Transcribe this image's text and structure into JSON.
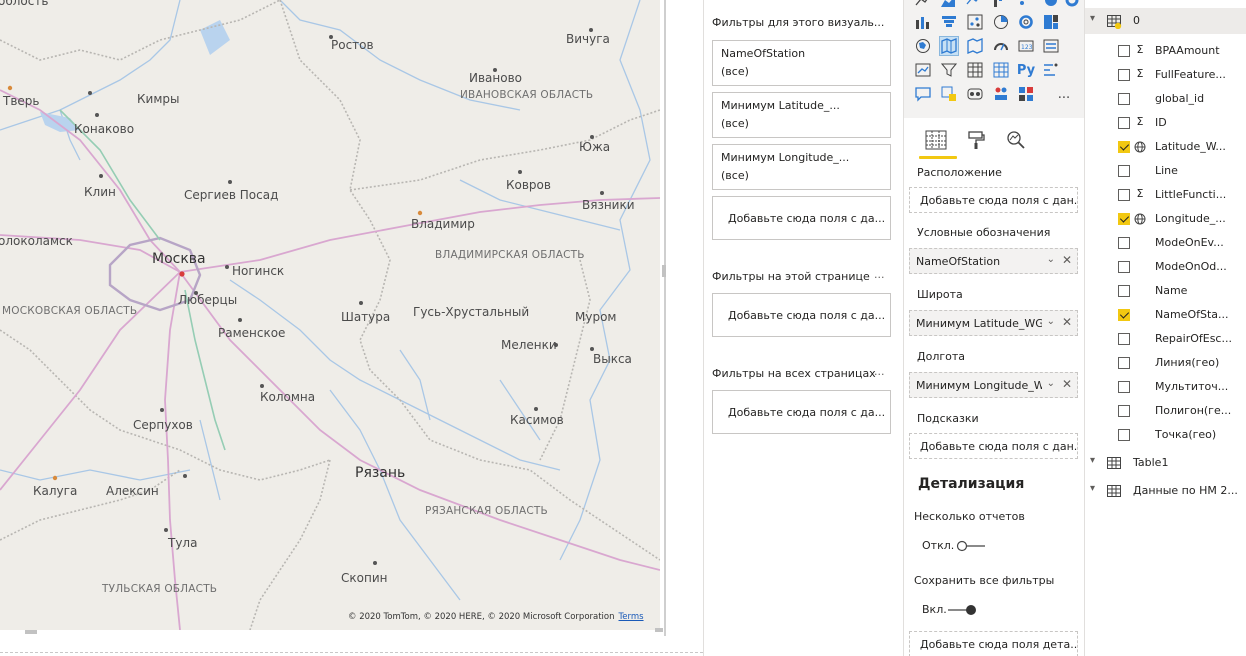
{
  "map": {
    "copyright": "© 2020 TomTom, © 2020 HERE, © 2020 Microsoft Corporation",
    "terms_link": "Terms",
    "cities": {
      "tver": "Тверь",
      "rostov": "Ростов",
      "vichuga": "Вичуга",
      "kimry": "Кимры",
      "ivanovo": "Иваново",
      "konakovo": "Конаково",
      "yuzha": "Южа",
      "klin": "Клин",
      "sergiev_posad": "Сергиев Посад",
      "kovrov": "Ковров",
      "vyazniki": "Вязники",
      "volokolamsk": "олоколамск",
      "vladimir": "Владимир",
      "moskva": "Москва",
      "noginsk": "Ногинск",
      "lyubertsy": "Люберцы",
      "shatura": "Шатура",
      "gus": "Гусь-Хрустальный",
      "murom": "Муром",
      "ramenskoe": "Раменское",
      "melenki": "Меленки",
      "vyksa": "Выкса",
      "kolomna": "Коломна",
      "serpukhov": "Серпухов",
      "kasimov": "Касимов",
      "ryazan": "Рязань",
      "kaluga": "Калуга",
      "aleksin": "Алексин",
      "tula": "Тула",
      "skopin": "Скопин"
    },
    "regions": {
      "ivanovo": "ИВАНОВСКАЯ ОБЛАСТЬ",
      "vladimir": "ВЛАДИМИРСКАЯ ОБЛАСТЬ",
      "moscow": "МОСКОВСКАЯ ОБЛАСТЬ",
      "ryazan": "РЯЗАНСКАЯ ОБЛАСТЬ",
      "tula": "ТУЛЬСКАЯ ОБЛАСТЬ"
    }
  },
  "filters": {
    "visual_title": "Фильтры для этого визуаль...",
    "more": "...",
    "cards": [
      {
        "name": "NameOfStation",
        "value": "(все)"
      },
      {
        "name": "Минимум Latitude_...",
        "value": "(все)"
      },
      {
        "name": "Минимум Longitude_...",
        "value": "(все)"
      }
    ],
    "add_field": "Добавьте сюда поля с да...",
    "page_title": "Фильтры на этой странице",
    "page_add": "Добавьте сюда поля с да...",
    "all_title": "Фильтры на всех страницах",
    "all_add": "Добавьте сюда поля с да..."
  },
  "viz": {
    "wells": {
      "location_label": "Расположение",
      "location_placeholder": "Добавьте сюда поля с дан...",
      "legend_label": "Условные обозначения",
      "legend_field": "NameOfStation",
      "lat_label": "Широта",
      "lat_field": "Минимум Latitude_WG",
      "lon_label": "Долгота",
      "lon_field": "Минимум Longitude_W",
      "tooltips_label": "Подсказки",
      "tooltips_placeholder": "Добавьте сюда поля с дан..."
    },
    "drill": {
      "title": "Детализация",
      "multi_label": "Несколько отчетов",
      "multi_state": "Откл.",
      "keep_label": "Сохранить все фильтры",
      "keep_state": "Вкл.",
      "drill_placeholder": "Добавьте сюда поля дета..."
    },
    "py_label": "Py",
    "more_label": "...",
    "accent": "#f2c811",
    "selected_icon": "filled-map"
  },
  "fields": {
    "tables": [
      {
        "name": "0",
        "expanded": true
      },
      {
        "name": "Table1",
        "expanded": false
      },
      {
        "name": "Данные по НМ 2...",
        "expanded": false
      }
    ],
    "items": [
      {
        "name": "BPAAmount",
        "type": "Σ",
        "checked": false
      },
      {
        "name": "FullFeature...",
        "type": "Σ",
        "checked": false
      },
      {
        "name": "global_id",
        "type": "",
        "checked": false
      },
      {
        "name": "ID",
        "type": "Σ",
        "checked": false
      },
      {
        "name": "Latitude_W...",
        "type": "globe",
        "checked": true
      },
      {
        "name": "Line",
        "type": "",
        "checked": false
      },
      {
        "name": "LittleFuncti...",
        "type": "Σ",
        "checked": false
      },
      {
        "name": "Longitude_...",
        "type": "globe",
        "checked": true
      },
      {
        "name": "ModeOnEv...",
        "type": "",
        "checked": false
      },
      {
        "name": "ModeOnOd...",
        "type": "",
        "checked": false
      },
      {
        "name": "Name",
        "type": "",
        "checked": false
      },
      {
        "name": "NameOfSta...",
        "type": "",
        "checked": true
      },
      {
        "name": "RepairOfEsc...",
        "type": "",
        "checked": false
      },
      {
        "name": "Линия(гео)",
        "type": "",
        "checked": false
      },
      {
        "name": "Мультиточ...",
        "type": "",
        "checked": false
      },
      {
        "name": "Полигон(ге...",
        "type": "",
        "checked": false
      },
      {
        "name": "Точка(гео)",
        "type": "",
        "checked": false
      }
    ]
  }
}
